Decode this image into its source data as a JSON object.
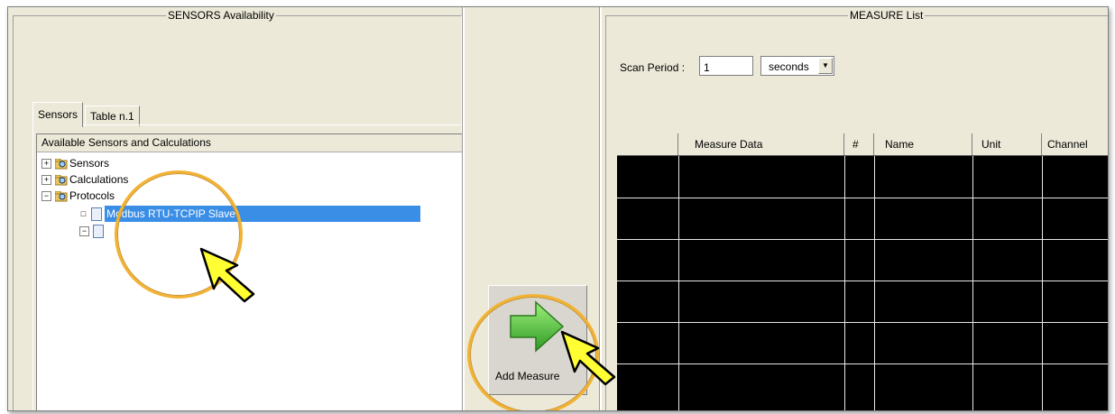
{
  "left_panel": {
    "group_title": "SENSORS Availability",
    "tabs": [
      {
        "label": "Sensors",
        "active": true
      },
      {
        "label": "Table n.1",
        "active": false
      }
    ],
    "tree": {
      "header": "Available Sensors and Calculations",
      "nodes": [
        {
          "label": "Sensors",
          "expander": "+"
        },
        {
          "label": "Calculations",
          "expander": "+"
        },
        {
          "label": "Protocols",
          "expander": "−"
        }
      ],
      "children": [
        {
          "label": "Modbus RTU-TCPIP Slave",
          "expander": "□",
          "selected": true
        },
        {
          "label": "",
          "expander": "−"
        }
      ]
    }
  },
  "add_button": {
    "label": "Add Measure",
    "icon": "green-right-arrow-icon"
  },
  "right_panel": {
    "group_title": "MEASURE List",
    "scan_period": {
      "label": "Scan Period :",
      "value": "1",
      "unit_selected": "seconds",
      "dropdown_glyph": "▼"
    },
    "table": {
      "columns": [
        "",
        "Measure Data",
        "#",
        "Name",
        "Unit",
        "Channel"
      ],
      "rows": 6
    }
  },
  "colors": {
    "window_bg": "#ece9d8",
    "selection": "#3a8ee6",
    "callout_ring": "#f2b233",
    "pointer_fill": "#ffff33",
    "arrow_green": "#4fc23a"
  }
}
